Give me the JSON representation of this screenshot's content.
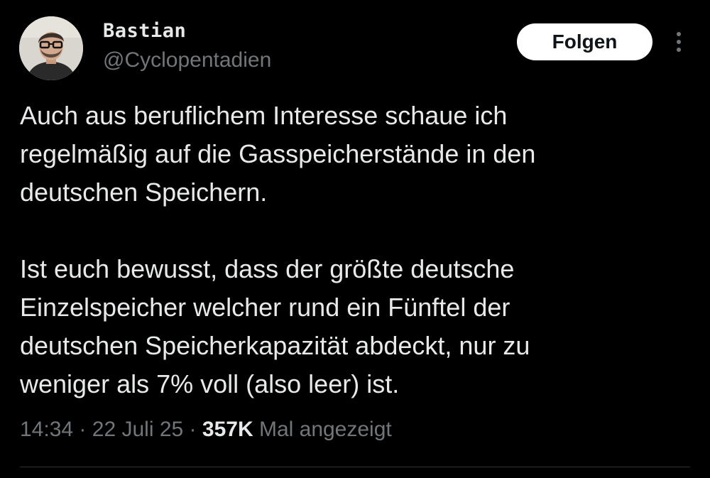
{
  "author": {
    "display_name": "Bastian",
    "handle": "@Cyclopentadien",
    "avatar_icon": "avatar-photo-person-with-glasses"
  },
  "actions": {
    "follow_label": "Folgen",
    "more_icon": "more-vertical-icon"
  },
  "tweet": {
    "paragraph1_lines": [
      "Auch aus beruflichem Interesse schaue ich",
      "regelmäßig auf die Gasspeicherstände in den",
      "deutschen Speichern."
    ],
    "paragraph2_lines": [
      "Ist euch bewusst, dass der größte deutsche",
      "Einzelspeicher welcher rund ein Fünftel der",
      "deutschen Speicherkapazität abdeckt, nur zu",
      "weniger als 7% voll (also leer) ist."
    ]
  },
  "meta": {
    "time": "14:34",
    "separator": "·",
    "date": "22 Juli 25",
    "views_count": "357K",
    "views_label": "Mal angezeigt"
  },
  "colors": {
    "background": "#000000",
    "text_primary": "#e7e9ea",
    "text_secondary": "#71767b",
    "button_bg": "#ffffff",
    "button_text": "#0f1419",
    "divider": "#2f3336"
  }
}
